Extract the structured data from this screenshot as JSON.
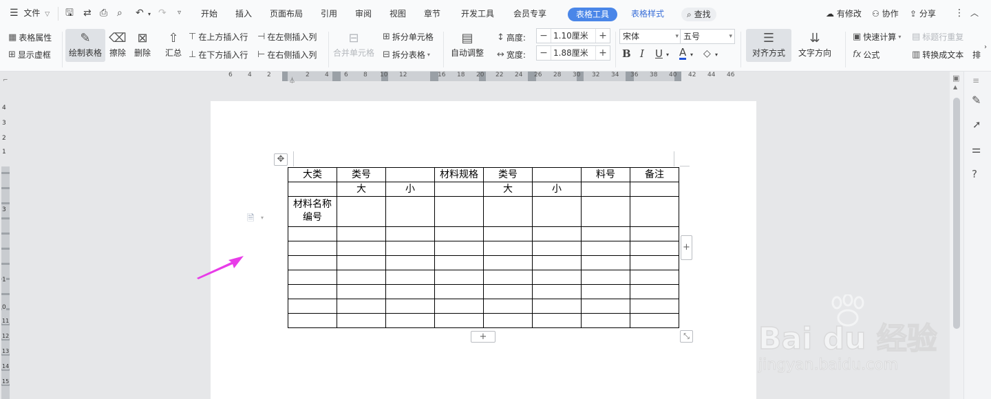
{
  "menubar": {
    "file_label": "文件",
    "tabs": [
      "开始",
      "插入",
      "页面布局",
      "引用",
      "审阅",
      "视图",
      "章节",
      "开发工具",
      "会员专享"
    ],
    "active_tab": "表格工具",
    "style_tab": "表格样式",
    "search_label": "查找",
    "has_changes": "有修改",
    "collaborate": "协作",
    "share": "分享"
  },
  "toolbar": {
    "table_props": "表格属性",
    "show_gridlines": "显示虚框",
    "draw_table": "绘制表格",
    "erase": "擦除",
    "delete": "删除",
    "summary": "汇总",
    "insert_above": "在上方插入行",
    "insert_below": "在下方插入行",
    "insert_left": "在左侧插入列",
    "insert_right": "在右侧插入列",
    "merge_cells": "合并单元格",
    "split_cells": "拆分单元格",
    "split_table": "拆分表格",
    "auto_adjust": "自动调整",
    "height_label": "高度:",
    "height_value": "1.10厘米",
    "width_label": "宽度:",
    "width_value": "1.88厘米",
    "font_name": "宋体",
    "font_size": "五号",
    "align": "对齐方式",
    "text_direction": "文字方向",
    "quick_calc": "快速计算",
    "header_repeat": "标题行重复",
    "formula": "公式",
    "to_text": "转换成文本",
    "more": "排"
  },
  "ruler": {
    "numbers": [
      "6",
      "4",
      "2",
      "2",
      "4",
      "6",
      "8",
      "10",
      "12",
      "16",
      "18",
      "20",
      "22",
      "24",
      "26",
      "28",
      "30",
      "32",
      "34",
      "36",
      "38",
      "40",
      "42",
      "44",
      "46"
    ],
    "left_numbers": [
      "4",
      "3",
      "2",
      "1",
      "3",
      "1",
      "0",
      "11",
      "12",
      "13",
      "14",
      "15"
    ]
  },
  "table": {
    "rows": [
      [
        "大类",
        "类号",
        "",
        "材料规格",
        "类号",
        "",
        "料号",
        "备注"
      ],
      [
        "",
        "大",
        "小",
        "",
        "大",
        "小",
        "",
        ""
      ],
      [
        "材料名称编号",
        "",
        "",
        "",
        "",
        "",
        "",
        ""
      ],
      [
        "",
        "",
        "",
        "",
        "",
        "",
        "",
        ""
      ],
      [
        "",
        "",
        "",
        "",
        "",
        "",
        "",
        ""
      ],
      [
        "",
        "",
        "",
        "",
        "",
        "",
        "",
        ""
      ],
      [
        "",
        "",
        "",
        "",
        "",
        "",
        "",
        ""
      ],
      [
        "",
        "",
        "",
        "",
        "",
        "",
        "",
        ""
      ],
      [
        "",
        "",
        "",
        "",
        "",
        "",
        "",
        ""
      ],
      [
        "",
        "",
        "",
        "",
        "",
        "",
        "",
        ""
      ]
    ]
  },
  "watermark": {
    "brand": "Bai du 经验",
    "url": "jingyan.baidu.com"
  },
  "colors": {
    "accent": "#4a86e8",
    "arrow": "#e83ce8"
  }
}
